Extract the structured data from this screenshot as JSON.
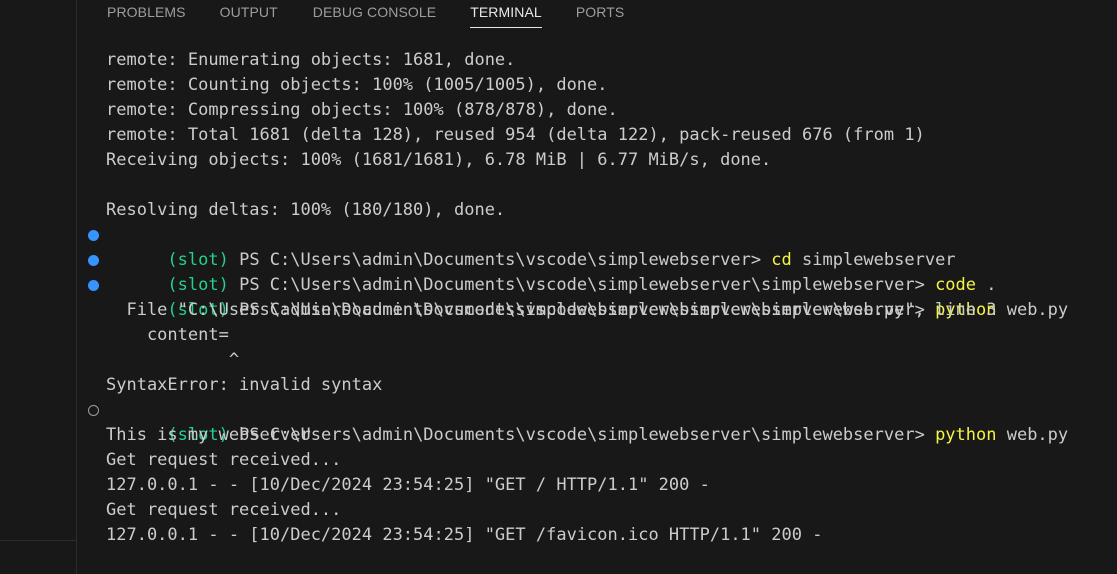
{
  "panel": {
    "tabs": [
      {
        "label": "PROBLEMS"
      },
      {
        "label": "OUTPUT"
      },
      {
        "label": "DEBUG CONSOLE"
      },
      {
        "label": "TERMINAL"
      },
      {
        "label": "PORTS"
      }
    ],
    "active_tab": "TERMINAL"
  },
  "terminal": {
    "lines": [
      {
        "text": "remote: Enumerating objects: 1681, done."
      },
      {
        "text": "remote: Counting objects: 100% (1005/1005), done."
      },
      {
        "text": "remote: Compressing objects: 100% (878/878), done."
      },
      {
        "text": "remote: Total 1681 (delta 128), reused 954 (delta 122), pack-reused 676 (from 1)"
      },
      {
        "text": "Receiving objects: 100% (1681/1681), 6.78 MiB | 6.77 MiB/s, done."
      },
      {
        "text": ""
      },
      {
        "text": "Resolving deltas: 100% (180/180), done."
      },
      {
        "env": "(slot)",
        "prompt": " PS C:\\Users\\admin\\Documents\\vscode\\simplewebserver> ",
        "command": "cd",
        "args": " simplewebserver"
      },
      {
        "env": "(slot)",
        "prompt": " PS C:\\Users\\admin\\Documents\\vscode\\simplewebserver\\simplewebserver> ",
        "command": "code",
        "args": " ."
      },
      {
        "env": "(slot)",
        "prompt": " PS C:\\Users\\admin\\Documents\\vscode\\simplewebserver\\simplewebserver> ",
        "command": "python",
        "args": " web.py"
      },
      {
        "text": "  File \"C:\\Users\\admin\\Documents\\vscode\\simplewebserver\\simplewebserver\\web.py\", line 3"
      },
      {
        "text": "    content="
      },
      {
        "text": "            ^"
      },
      {
        "text": "SyntaxError: invalid syntax"
      },
      {
        "env": "(slot)",
        "prompt": " PS C:\\Users\\admin\\Documents\\vscode\\simplewebserver\\simplewebserver> ",
        "command": "python",
        "args": " web.py"
      },
      {
        "text": "This is my webserver"
      },
      {
        "text": "Get request received..."
      },
      {
        "text": "127.0.0.1 - - [10/Dec/2024 23:54:25] \"GET / HTTP/1.1\" 200 -"
      },
      {
        "text": "Get request received..."
      },
      {
        "text": "127.0.0.1 - - [10/Dec/2024 23:54:25] \"GET /favicon.ico HTTP/1.1\" 200 -"
      }
    ]
  },
  "colors": {
    "background": "#181818",
    "text": "#cccccc",
    "env": "#23d18b",
    "command": "#f5f543",
    "decoration_success": "#3794ff",
    "decoration_pending": "#9d9d9d"
  }
}
